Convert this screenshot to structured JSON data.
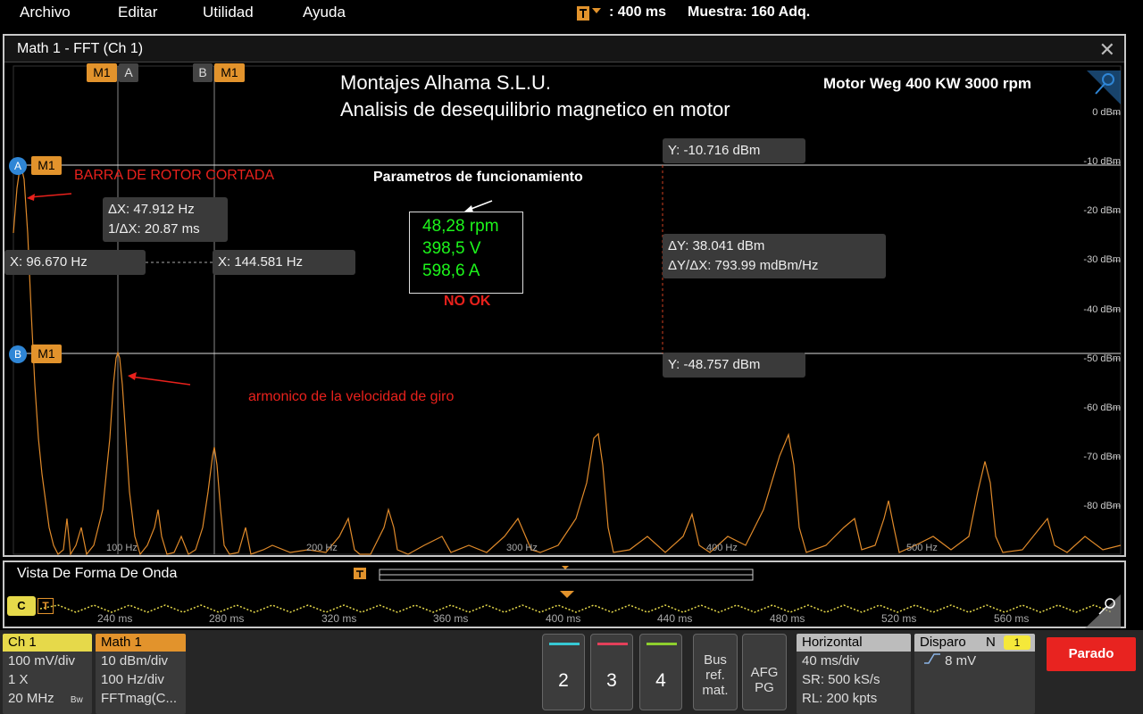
{
  "menu": {
    "items": [
      "Archivo",
      "Editar",
      "Utilidad",
      "Ayuda"
    ]
  },
  "status": {
    "time_scale": ": 400 ms",
    "acquisition": "Muestra: 160 Adq."
  },
  "math_window": {
    "title": "Math 1 - FFT (Ch 1)",
    "close": "✕",
    "heading_line1": "Montajes Alhama S.L.U.",
    "heading_line2": "Analisis de desequilibrio magnetico en motor",
    "motor_label": "Motor Weg 400 KW 3000 rpm",
    "cursor_tags": {
      "m1": "M1",
      "a": "A",
      "b": "B"
    },
    "readouts": {
      "delta_x": "ΔX: 47.912 Hz",
      "inv_delta_x": "1/ΔX: 20.87 ms",
      "x_a": "X: 96.670 Hz",
      "x_b": "X: 144.581 Hz",
      "y_a": "Y: -10.716 dBm",
      "delta_y": "ΔY: 38.041 dBm",
      "dy_dx": "ΔY/ΔX: 793.99 mdBm/Hz",
      "y_b": "Y: -48.757 dBm"
    },
    "annotations": {
      "broken_bar": "BARRA DE ROTOR CORTADA",
      "harmonic": "armonico de la velocidad de giro",
      "params_title": "Parametros de funcionamiento",
      "params": [
        "48,28 rpm",
        "398,5 V",
        "598,6 A"
      ],
      "status": "NO OK"
    },
    "y_axis": [
      "0 dBm",
      "-10 dBm",
      "-20 dBm",
      "-30 dBm",
      "-40 dBm",
      "-50 dBm",
      "-60 dBm",
      "-70 dBm",
      "-80 dBm"
    ],
    "x_axis": [
      "100 Hz",
      "200 Hz",
      "300 Hz",
      "400 Hz",
      "500 Hz"
    ]
  },
  "waveform_view": {
    "title": "Vista De Forma De Onda",
    "ch_tag": "C",
    "trig_tag": "T",
    "time_labels": [
      "240 ms",
      "280 ms",
      "320 ms",
      "360 ms",
      "400 ms",
      "440 ms",
      "480 ms",
      "520 ms",
      "560 ms"
    ]
  },
  "bottom_bar": {
    "ch1": {
      "title": "Ch 1",
      "lines": [
        "100 mV/div",
        "1 X",
        "20 MHz"
      ],
      "bw": "Bw"
    },
    "math1": {
      "title": "Math 1",
      "lines": [
        "10 dBm/div",
        "100 Hz/div",
        "FFTmag(C..."
      ]
    },
    "channels": [
      "2",
      "3",
      "4"
    ],
    "bus_btn": [
      "Bus",
      "ref.",
      "mat."
    ],
    "afg_btn": [
      "AFG",
      "PG"
    ],
    "horizontal": {
      "title": "Horizontal",
      "lines": [
        "40 ms/div",
        "SR: 500 kS/s",
        "RL: 200 kpts"
      ]
    },
    "trigger": {
      "title": "Disparo",
      "mode": "N",
      "count": "1",
      "level": "8 mV"
    },
    "run_state": "Parado"
  },
  "colors": {
    "fft_trace": "#e08a2a",
    "ch1_trace": "#e6d94a",
    "math_badge": "#e2932c",
    "ch1_badge": "#e6d94a",
    "stop": "#e82320",
    "annotation": "#e8211c",
    "params": "#1df51b"
  }
}
